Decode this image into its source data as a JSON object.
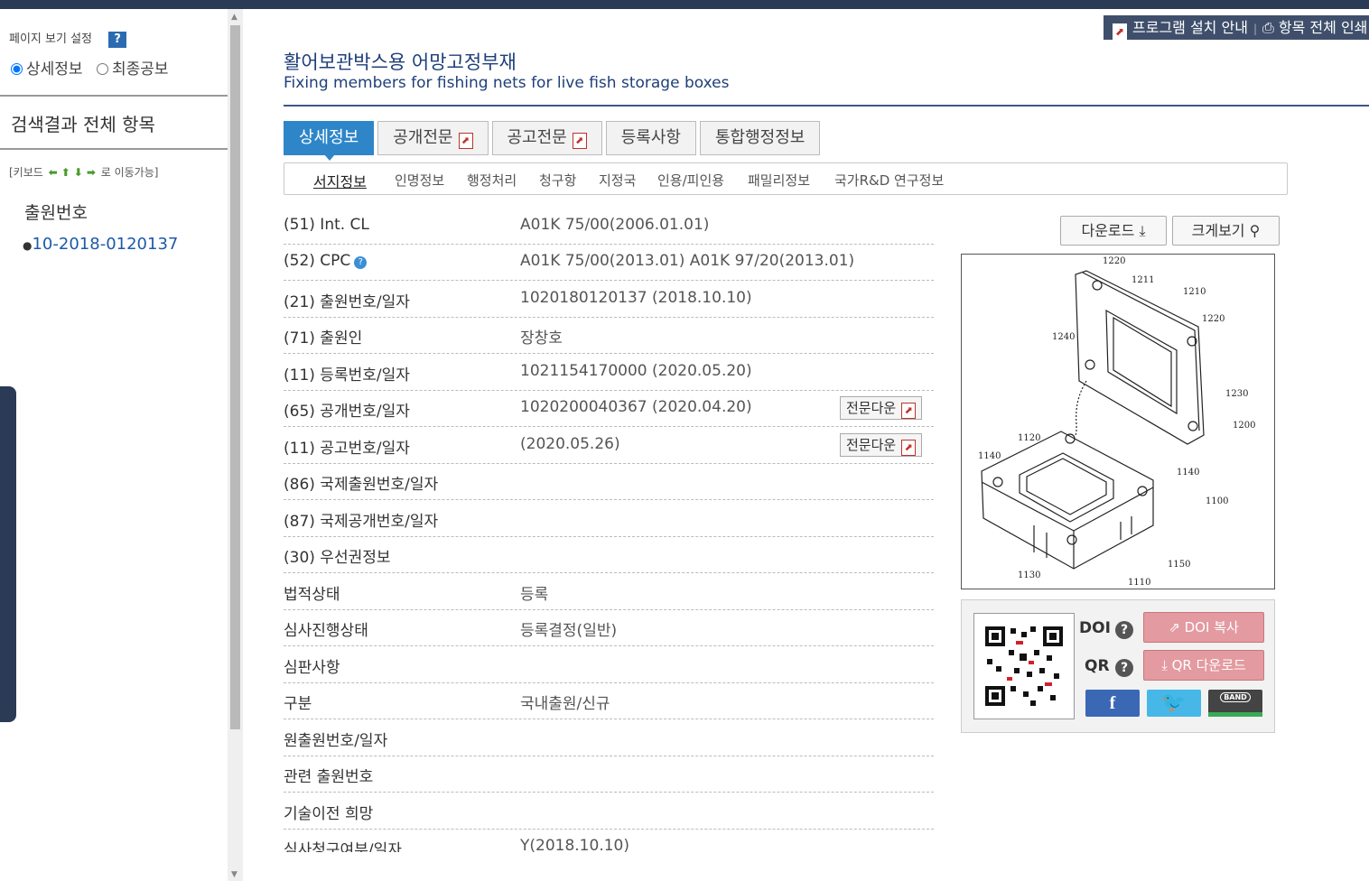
{
  "left_panel": {
    "view_setting_label": "페이지 보기 설정",
    "help_label": "?",
    "radio_detail": "상세정보",
    "radio_final": "최종공보",
    "result_title": "검색결과 전체 항목",
    "keyboard_prefix": "[키보드",
    "keyboard_suffix": "로 이동가능]",
    "application_label": "출원번호",
    "application_link": "10-2018-0120137"
  },
  "top_actions": {
    "install_guide": "프로그램 설치 안내",
    "print_all": "항목 전체 인쇄"
  },
  "title": {
    "korean": "활어보관박스용 어망고정부재",
    "english": "Fixing members for fishing nets for live fish storage boxes"
  },
  "tabs": [
    {
      "label": "상세정보"
    },
    {
      "label": "공개전문"
    },
    {
      "label": "공고전문"
    },
    {
      "label": "등록사항"
    },
    {
      "label": "통합행정정보"
    }
  ],
  "subnav": [
    "서지정보",
    "인명정보",
    "행정처리",
    "청구항",
    "지정국",
    "인용/피인용",
    "패밀리정보",
    "국가R&D 연구정보"
  ],
  "rows": [
    {
      "label": "(51) Int. CL",
      "value": "A01K 75/00(2006.01.01)"
    },
    {
      "label": "(52) CPC",
      "value": "A01K 75/00(2013.01) A01K 97/20(2013.01)"
    },
    {
      "label": "(21) 출원번호/일자",
      "value": "1020180120137 (2018.10.10)"
    },
    {
      "label": "(71) 출원인",
      "value": "장창호"
    },
    {
      "label": "(11) 등록번호/일자",
      "value": "1021154170000 (2020.05.20)"
    },
    {
      "label": "(65) 공개번호/일자",
      "value": "1020200040367 (2020.04.20)"
    },
    {
      "label": "(11) 공고번호/일자",
      "value": "(2020.05.26)"
    },
    {
      "label": "(86) 국제출원번호/일자",
      "value": ""
    },
    {
      "label": "(87) 국제공개번호/일자",
      "value": ""
    },
    {
      "label": "(30) 우선권정보",
      "value": ""
    },
    {
      "label": "법적상태",
      "value": "등록"
    },
    {
      "label": "심사진행상태",
      "value": "등록결정(일반)"
    },
    {
      "label": "심판사항",
      "value": ""
    },
    {
      "label": "구분",
      "value": "국내출원/신규"
    },
    {
      "label": "원출원번호/일자",
      "value": ""
    },
    {
      "label": "관련 출원번호",
      "value": ""
    },
    {
      "label": "기술이전 희망",
      "value": ""
    },
    {
      "label": "심사청구여부/일자",
      "value": "Y(2018.10.10)"
    }
  ],
  "full_download_label": "전문다운",
  "drawing": {
    "download_label": "다운로드",
    "zoom_label": "크게보기",
    "labels": [
      "1220",
      "1211",
      "1210",
      "1220",
      "1240",
      "1230",
      "1200",
      "1120",
      "1140",
      "1140",
      "1100",
      "1150",
      "1130",
      "1110"
    ]
  },
  "share": {
    "doi_label": "DOI",
    "qr_label": "QR",
    "doi_copy": "DOI 복사",
    "qr_download": "QR 다운로드",
    "facebook": "f",
    "band": "BAND"
  },
  "colors": {
    "accent": "#2e86c9",
    "navy": "#2b3a55",
    "title": "#1e3f7a",
    "pink_button": "#e39aa0"
  }
}
